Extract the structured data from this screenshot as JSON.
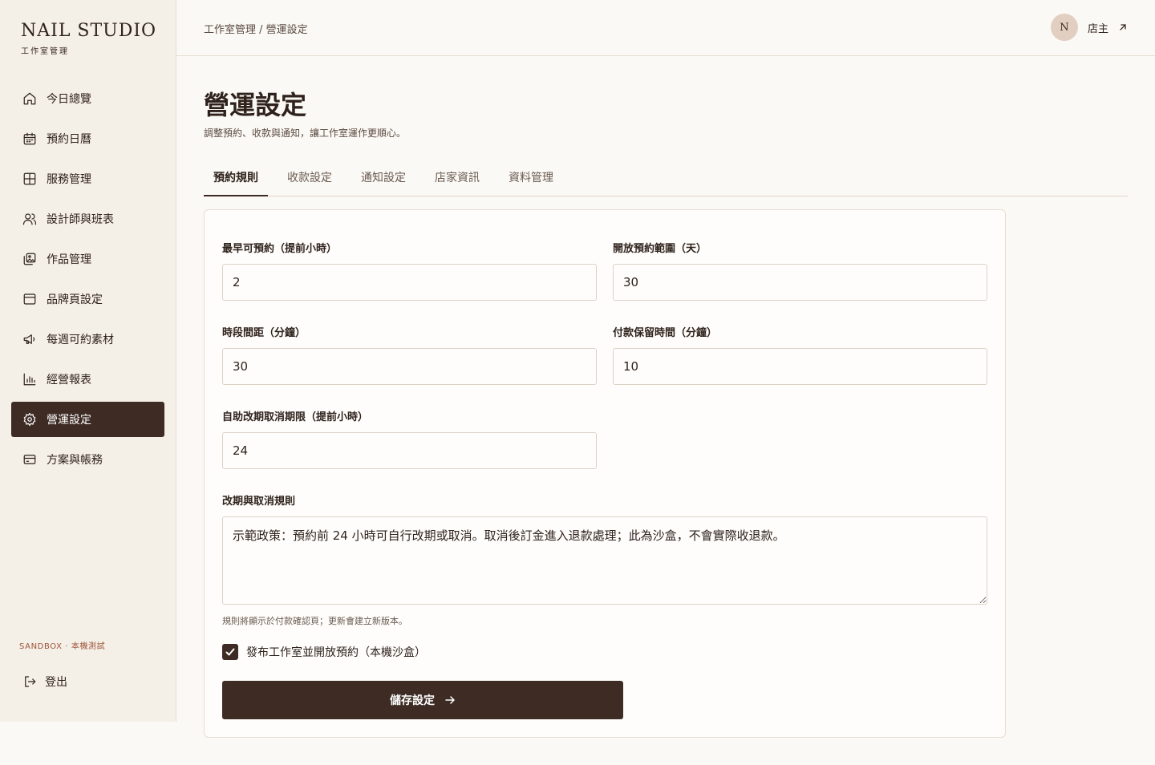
{
  "brand": {
    "title": "NAIL STUDIO",
    "subtitle": "工作室管理"
  },
  "sidebar": {
    "items": [
      {
        "label": "今日總覽",
        "icon": "home-icon"
      },
      {
        "label": "預約日曆",
        "icon": "calendar-icon"
      },
      {
        "label": "服務管理",
        "icon": "grid-icon"
      },
      {
        "label": "設計師與班表",
        "icon": "users-icon"
      },
      {
        "label": "作品管理",
        "icon": "gallery-icon"
      },
      {
        "label": "品牌頁設定",
        "icon": "browser-icon"
      },
      {
        "label": "每週可約素材",
        "icon": "megaphone-icon"
      },
      {
        "label": "經營報表",
        "icon": "bar-chart-icon"
      },
      {
        "label": "營運設定",
        "icon": "gear-icon",
        "active": true
      },
      {
        "label": "方案與帳務",
        "icon": "credit-card-icon"
      }
    ],
    "sandbox": "SANDBOX · 本機測試",
    "logout": "登出"
  },
  "header": {
    "breadcrumb": "工作室管理 / 營運設定",
    "avatar_initial": "N",
    "user_name": "店主"
  },
  "page": {
    "title": "營運設定",
    "subtitle": "調整預約、收款與通知，讓工作室運作更順心。"
  },
  "tabs": [
    "預約規則",
    "收款設定",
    "通知設定",
    "店家資訊",
    "資料管理"
  ],
  "form": {
    "earliest_booking": {
      "label": "最早可預約（提前小時）",
      "value": "2"
    },
    "booking_range": {
      "label": "開放預約範圍（天）",
      "value": "30"
    },
    "slot_interval": {
      "label": "時段間距（分鐘）",
      "value": "30"
    },
    "payment_hold": {
      "label": "付款保留時間（分鐘）",
      "value": "10"
    },
    "self_reschedule": {
      "label": "自助改期取消期限（提前小時）",
      "value": "24"
    },
    "policy": {
      "label": "改期與取消規則",
      "value": "示範政策：預約前 24 小時可自行改期或取消。取消後訂金進入退款處理；此為沙盒，不會實際收退款。",
      "hint": "規則將顯示於付款確認頁；更新會建立新版本。"
    },
    "publish": {
      "label": "發布工作室並開放預約（本機沙盒）",
      "checked": true
    },
    "save_label": "儲存設定"
  },
  "colors": {
    "accent": "#3d2b24",
    "sidebar_bg": "#f4efe7",
    "page_bg": "#fbf9f5",
    "avatar_bg": "#e2cfc2",
    "sandbox_text": "#a0553a"
  }
}
